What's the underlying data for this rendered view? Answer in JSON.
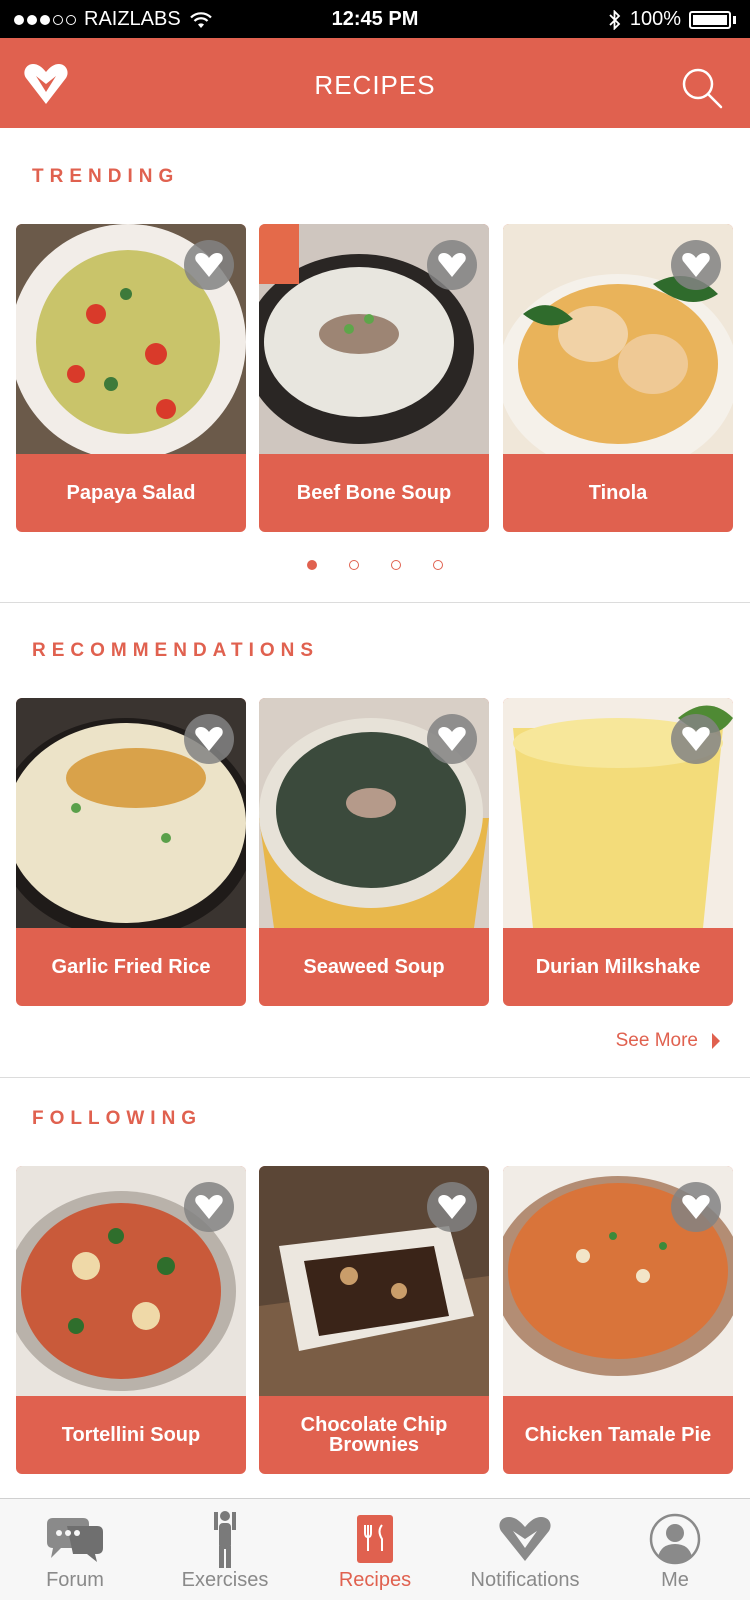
{
  "status_bar": {
    "carrier": "RAIZLABS",
    "time": "12:45 PM",
    "battery": "100%"
  },
  "nav": {
    "title": "RECIPES",
    "logo_icon": "heart-logo-icon",
    "search_icon": "search-icon"
  },
  "trending": {
    "title": "TRENDING",
    "items": [
      {
        "label": "Papaya Salad"
      },
      {
        "label": "Beef Bone Soup"
      },
      {
        "label": "Tinola"
      }
    ],
    "page_count": 4,
    "active_page": 1
  },
  "recommendations": {
    "title": "RECOMMENDATIONS",
    "items": [
      {
        "label": "Garlic Fried Rice"
      },
      {
        "label": "Seaweed Soup"
      },
      {
        "label": "Durian Milkshake"
      }
    ],
    "see_more": "See More"
  },
  "following": {
    "title": "FOLLOWING",
    "items": [
      {
        "label": "Tortellini Soup"
      },
      {
        "label": "Chocolate Chip Brownies"
      },
      {
        "label": "Chicken Tamale Pie"
      }
    ]
  },
  "tabs": [
    {
      "label": "Forum",
      "icon": "chat-bubbles-icon"
    },
    {
      "label": "Exercises",
      "icon": "person-icon"
    },
    {
      "label": "Recipes",
      "icon": "recipe-book-icon",
      "active": true
    },
    {
      "label": "Notifications",
      "icon": "heart-icon"
    },
    {
      "label": "Me",
      "icon": "avatar-icon"
    }
  ],
  "colors": {
    "accent": "#e0614f",
    "tab_inactive": "#8a8a8a"
  }
}
